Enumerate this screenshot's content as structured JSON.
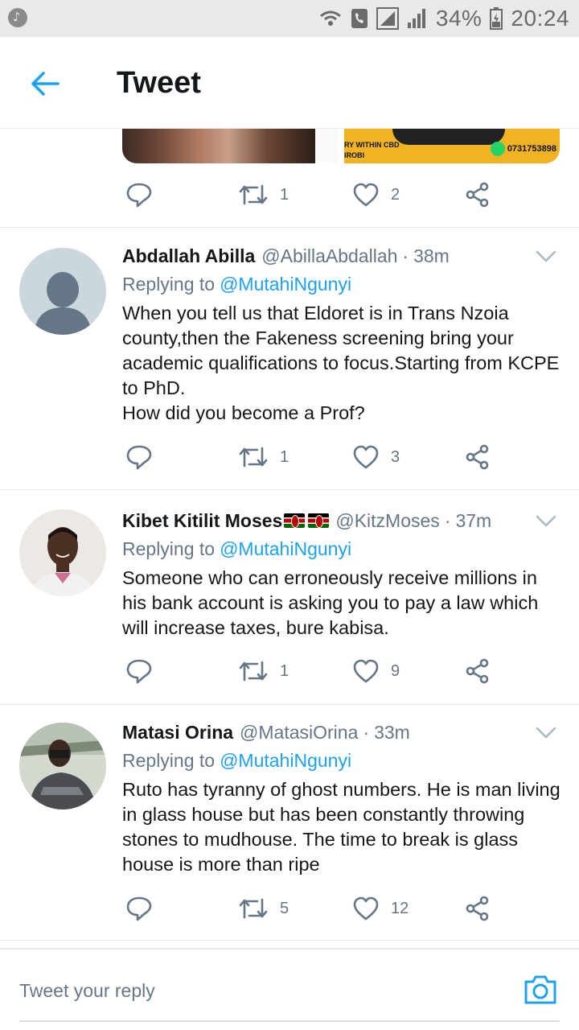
{
  "status_bar": {
    "battery": "34%",
    "time": "20:24"
  },
  "header": {
    "title": "Tweet"
  },
  "top_media": {
    "caption_line1": "RY WITHIN CBD",
    "caption_line2": "IROBI",
    "phone": "0731753898"
  },
  "top_actions": {
    "retweets": "1",
    "likes": "2"
  },
  "tweets": [
    {
      "name": "Abdallah Abilla",
      "handle": "@AbillaAbdallah",
      "dot": "·",
      "time": "38m",
      "replying_label": "Replying to",
      "replying_to": "@MutahiNgunyi",
      "text": "When you tell us that Eldoret is in Trans Nzoia county,then the Fakeness screening bring your academic qualifications to focus.Starting from KCPE to PhD.\nHow did you become a Prof?",
      "retweets": "1",
      "likes": "3"
    },
    {
      "name": "Kibet Kitilit Moses",
      "handle": "@KitzMoses",
      "dot": "·",
      "time": "37m",
      "replying_label": "Replying to",
      "replying_to": "@MutahiNgunyi",
      "text": "Someone who can erroneously receive millions in his bank account is asking you to pay a law which will increase taxes, bure kabisa.",
      "retweets": "1",
      "likes": "9"
    },
    {
      "name": "Matasi Orina",
      "handle": "@MatasiOrina",
      "dot": "·",
      "time": "33m",
      "replying_label": "Replying to",
      "replying_to": "@MutahiNgunyi",
      "text": "Ruto has tyranny of ghost numbers. He is man living in glass house but has been constantly throwing stones to mudhouse. The time to break is glass house is more than ripe",
      "retweets": "5",
      "likes": "12"
    }
  ],
  "compose": {
    "placeholder": "Tweet your reply"
  },
  "colors": {
    "accent": "#1da1f2",
    "secondary_text": "#657786",
    "primary_text": "#14171a"
  },
  "icons": [
    "back-arrow-icon",
    "reply-icon",
    "retweet-icon",
    "like-icon",
    "share-icon",
    "chevron-down-icon",
    "camera-icon"
  ]
}
